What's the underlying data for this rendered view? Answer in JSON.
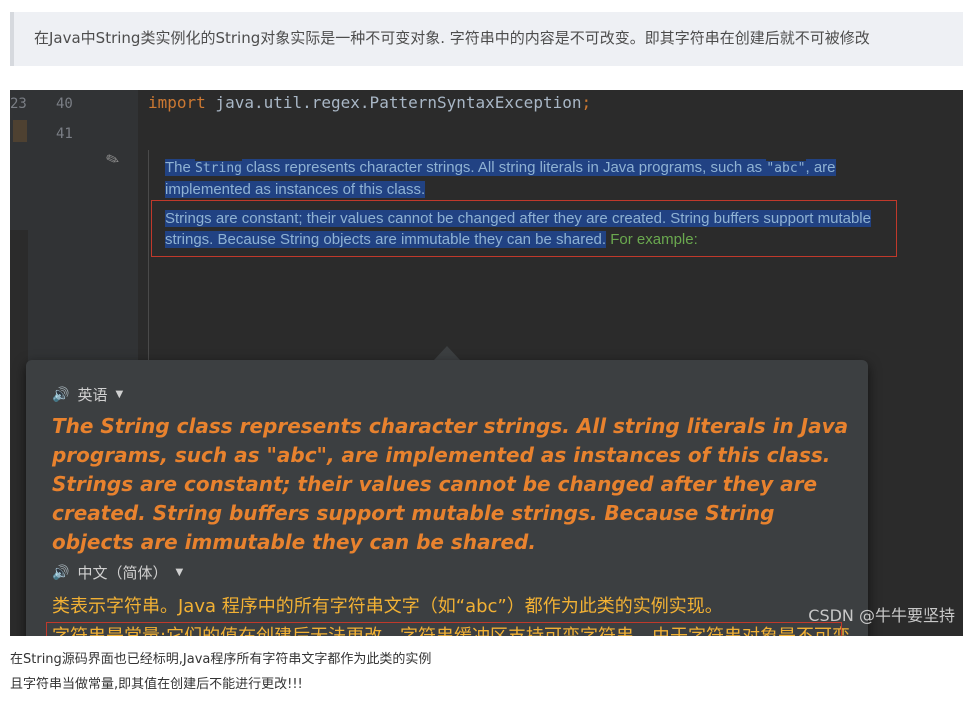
{
  "quote": {
    "text": "在Java中String类实例化的String对象实际是一种不可变对象. 字符串中的内容是不可改变。即其字符串在创建后就不可被修改"
  },
  "editor": {
    "line_numbers": [
      "23",
      "40",
      "41"
    ],
    "code_keyword": "import",
    "code_rest": " java.util.regex.PatternSyntaxException",
    "code_semicolon": ";",
    "doc_p1_a": "The ",
    "doc_p1_code": "String",
    "doc_p1_b": " class represents character strings. All string literals in Java programs, such as ",
    "doc_p1_code2": "\"abc\"",
    "doc_p1_c": ", are implemented as instances of this class.",
    "doc_p2_a": "Strings are constant; their values cannot be changed after they are created. String buffers support mutable strings. Because String objects are immutable they can be shared.",
    "doc_p2_b": " For example:"
  },
  "popup": {
    "source_lang": "英语",
    "source_text": "The String class represents character strings. All string literals in Java programs, such as \"abc\", are implemented as instances of this class. Strings are constant; their values cannot be changed after they are created. String buffers support mutable strings. Because String objects are immutable they can be shared.",
    "target_lang": "中文（简体）",
    "target_line1": "类表示字符串。Java 程序中的所有字符串文字（如“abc”）都作为此类的实例实现。",
    "target_line2": "字符串是常量;它们的值在创建后无法更改。字符串缓冲区支持可变字符串。由于字符串对象是不可变的，因此可以共享它们。"
  },
  "watermark": "CSDN @牛牛要坚持",
  "captions": {
    "line1": "在String源码界面也已经标明,Java程序所有字符串文字都作为此类的实例",
    "line2": "且字符串当做常量,即其值在创建后不能进行更改!!!"
  },
  "colors": {
    "keyword": "#cc7832",
    "doc_text": "#8fb2d3",
    "selection": "#214283",
    "english": "#e8822e",
    "chinese": "#f2b134",
    "annotation_box": "#c0392b"
  }
}
